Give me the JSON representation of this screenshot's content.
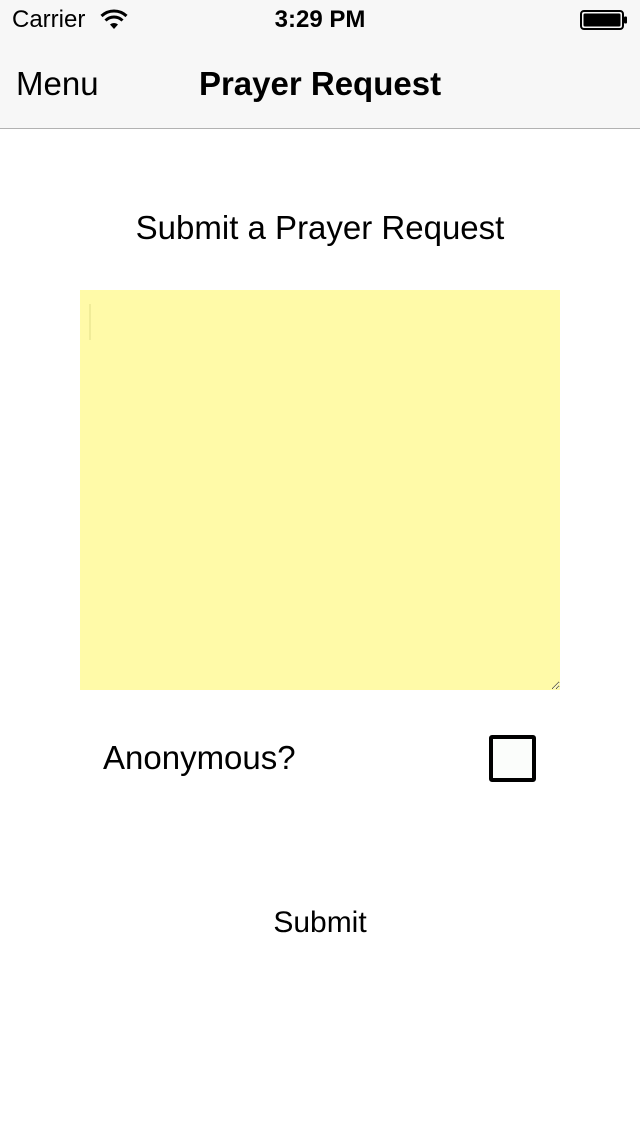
{
  "status_bar": {
    "carrier": "Carrier",
    "time": "3:29 PM",
    "wifi_icon": "wifi-icon",
    "battery_icon": "battery-icon"
  },
  "nav_bar": {
    "menu_label": "Menu",
    "title": "Prayer Request"
  },
  "form": {
    "heading": "Submit a Prayer Request",
    "request_text": "",
    "request_background": "#fffaa8",
    "anonymous_label": "Anonymous?",
    "anonymous_checked": false,
    "submit_label": "Submit"
  }
}
